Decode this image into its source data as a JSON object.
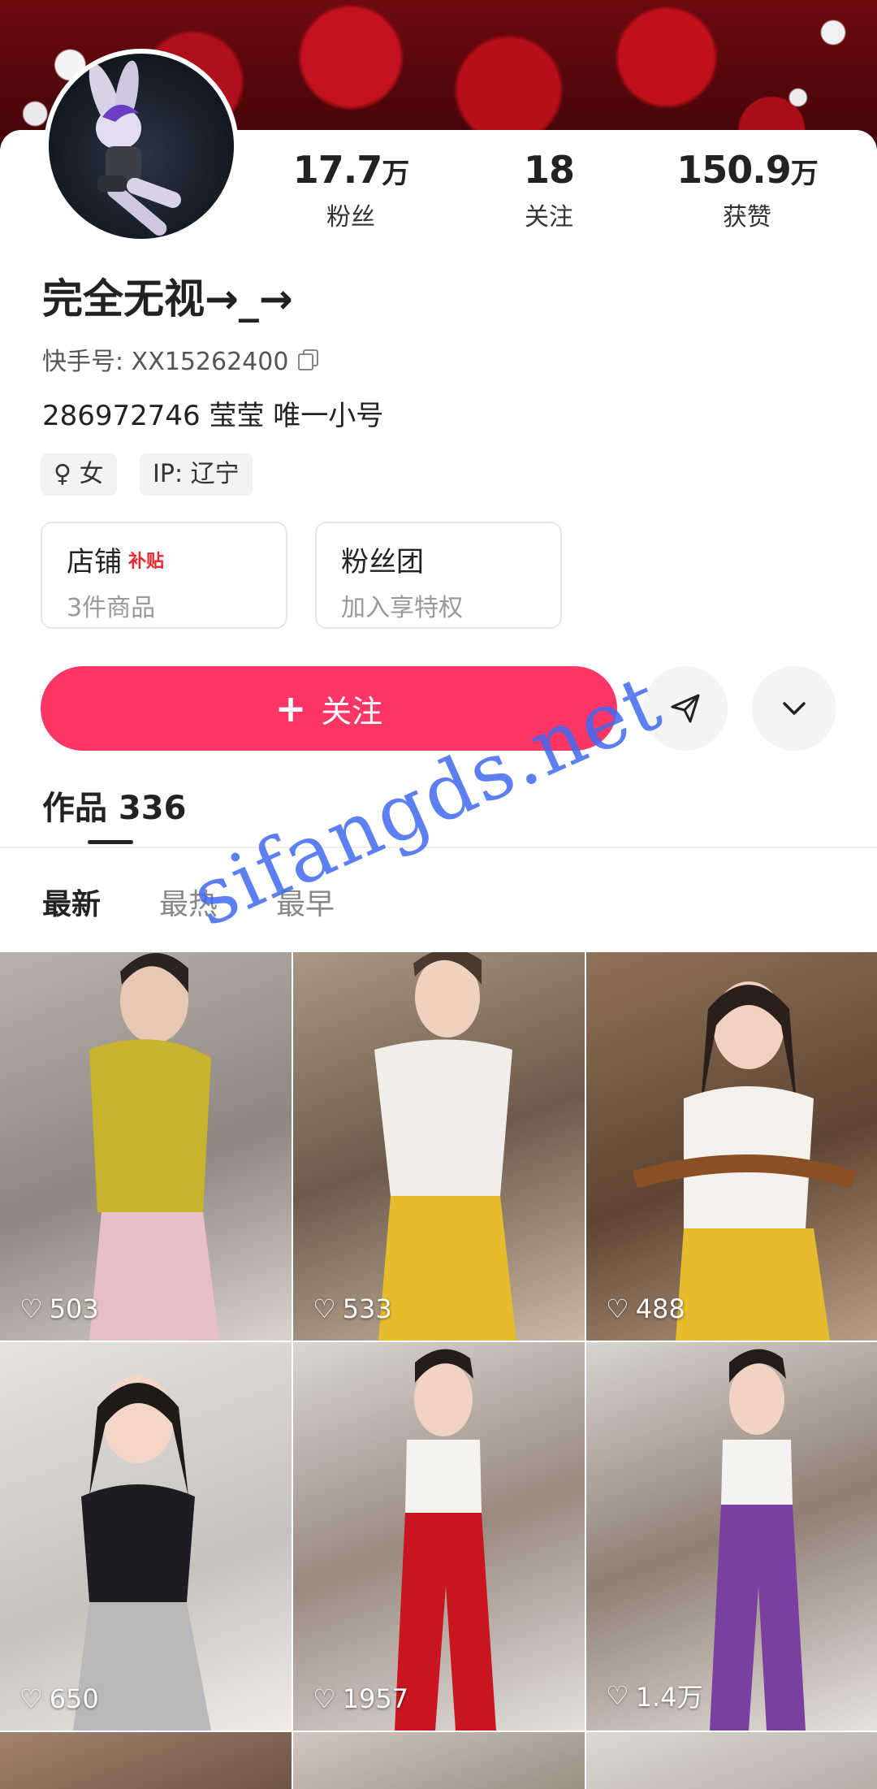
{
  "profile": {
    "name": "完全无视→_→",
    "kuaishou_id": "快手号: XX15262400",
    "bio": "286972746  莹莹 唯一小号",
    "tags": [
      {
        "icon": "female-icon",
        "label": "女"
      },
      {
        "label": "IP: 辽宁"
      }
    ]
  },
  "stats": [
    {
      "num": "17.7",
      "unit": "万",
      "label": "粉丝"
    },
    {
      "num": "18",
      "unit": "",
      "label": "关注"
    },
    {
      "num": "150.9",
      "unit": "万",
      "label": "获赞"
    }
  ],
  "cards": [
    {
      "title": "店铺",
      "badge": "补贴",
      "sub": "3件商品"
    },
    {
      "title": "粉丝团",
      "badge": "",
      "sub": "加入享特权"
    }
  ],
  "actions": {
    "follow_label": "关注"
  },
  "works_tab": "作品 336",
  "sort_tabs": [
    "最新",
    "最热",
    "最早"
  ],
  "videos": [
    {
      "likes": "503"
    },
    {
      "likes": "533"
    },
    {
      "likes": "488"
    },
    {
      "likes": "650"
    },
    {
      "likes": "1957"
    },
    {
      "likes": "1.4万"
    }
  ],
  "watermark": "sifangds.net",
  "colors": {
    "accent": "#fe3666",
    "watermark": "#406af0"
  }
}
